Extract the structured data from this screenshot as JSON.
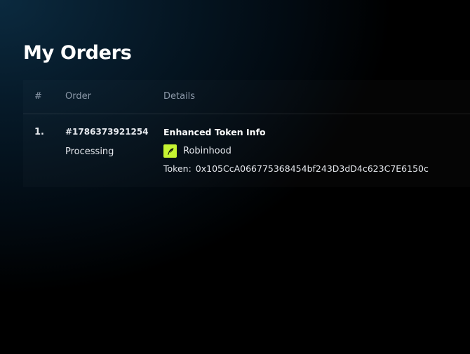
{
  "page": {
    "title": "My Orders"
  },
  "table": {
    "columns": [
      "#",
      "Order",
      "Details"
    ],
    "rows": [
      {
        "index": "1.",
        "order_id": "#1786373921254",
        "status": "Processing",
        "detail_title": "Enhanced Token Info",
        "chain_name": "Robinhood",
        "chain_icon": "robinhood-feather-icon",
        "token_label": "Token:",
        "token_address": "0x105CcA066775368454bf243D3dD4c623C7E6150c"
      }
    ]
  },
  "colors": {
    "background": "#000000",
    "header_text": "#8b98a8",
    "chain_icon_bg": "#c6f432"
  }
}
